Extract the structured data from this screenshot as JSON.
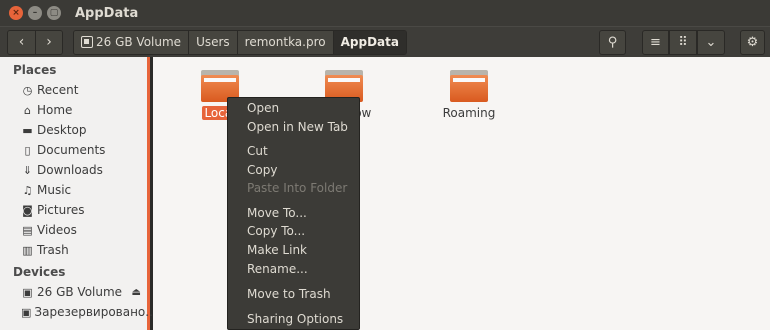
{
  "window": {
    "title": "AppData",
    "controls": {
      "close": "×",
      "minimize": "–",
      "maximize": "▢"
    }
  },
  "toolbar": {
    "back_icon": "‹",
    "forward_icon": "›",
    "breadcrumbs": [
      "26 GB Volume",
      "Users",
      "remontka.pro",
      "AppData"
    ],
    "search_icon": "⚲",
    "list_view_icon": "≡",
    "grid_view_icon": "⠿",
    "dropdown_icon": "⌄",
    "settings_icon": "⚙"
  },
  "sidebar": {
    "places_heading": "Places",
    "places": [
      {
        "label": "Recent",
        "icon": "◷"
      },
      {
        "label": "Home",
        "icon": "⌂"
      },
      {
        "label": "Desktop",
        "icon": "▬"
      },
      {
        "label": "Documents",
        "icon": "▯"
      },
      {
        "label": "Downloads",
        "icon": "⇓"
      },
      {
        "label": "Music",
        "icon": "♫"
      },
      {
        "label": "Pictures",
        "icon": "◙"
      },
      {
        "label": "Videos",
        "icon": "▤"
      },
      {
        "label": "Trash",
        "icon": "▥"
      }
    ],
    "devices_heading": "Devices",
    "devices": [
      {
        "label": "26 GB Volume",
        "icon": "▣",
        "eject": "⏏"
      },
      {
        "label": "Зарезервировано...",
        "icon": "▣"
      }
    ]
  },
  "folders": [
    {
      "label": "Local",
      "selected": true
    },
    {
      "label": "LocalLow",
      "selected": false
    },
    {
      "label": "Roaming",
      "selected": false
    }
  ],
  "context_menu": {
    "items": [
      {
        "label": "Open",
        "enabled": true
      },
      {
        "label": "Open in New Tab",
        "enabled": true
      },
      {
        "label": "Cut",
        "enabled": true
      },
      {
        "label": "Copy",
        "enabled": true
      },
      {
        "label": "Paste Into Folder",
        "enabled": false
      },
      {
        "label": "Move To...",
        "enabled": true
      },
      {
        "label": "Copy To...",
        "enabled": true
      },
      {
        "label": "Make Link",
        "enabled": true
      },
      {
        "label": "Rename...",
        "enabled": true
      },
      {
        "label": "Move to Trash",
        "enabled": true
      },
      {
        "label": "Sharing Options",
        "enabled": true
      }
    ]
  },
  "colors": {
    "accent": "#e7643a",
    "titlebar": "#3b3a36",
    "menu_bg": "#3c3b37",
    "sidebar_bg": "#f2f1f0",
    "content_bg": "#f7f5f3"
  }
}
